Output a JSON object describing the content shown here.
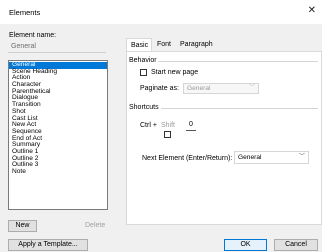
{
  "window": {
    "title": "Elements",
    "close_glyph": "✕"
  },
  "left_panel": {
    "element_name_label": "Element name:",
    "element_name_value": "General",
    "elements": [
      "General",
      "Scene Heading",
      "Action",
      "Character",
      "Parenthetical",
      "Dialogue",
      "Transition",
      "Shot",
      "Cast List",
      "New Act",
      "Sequence",
      "End of Act",
      "Summary",
      "Outline 1",
      "Outline 2",
      "Outline 3",
      "Note"
    ],
    "selected_index": 0,
    "new_label": "New",
    "delete_label": "Delete",
    "apply_template_label": "Apply a Template..."
  },
  "tabs": [
    "Basic",
    "Font",
    "Paragraph"
  ],
  "active_tab": "Basic",
  "behavior": {
    "heading": "Behavior",
    "start_new_page_label": "Start new page",
    "start_new_page_checked": false,
    "paginate_as_label": "Paginate as:",
    "paginate_as_value": "General"
  },
  "shortcuts": {
    "heading": "Shortcuts",
    "ctrl_label": "Ctrl +",
    "shift_label": "Shift",
    "shift_checked": false,
    "key_value": "0",
    "next_element_label": "Next Element (Enter/Return):",
    "next_element_value": "General"
  },
  "footer": {
    "ok_label": "OK",
    "cancel_label": "Cancel"
  },
  "colors": {
    "selection": "#0078d7",
    "background": "#f0f0f0"
  }
}
